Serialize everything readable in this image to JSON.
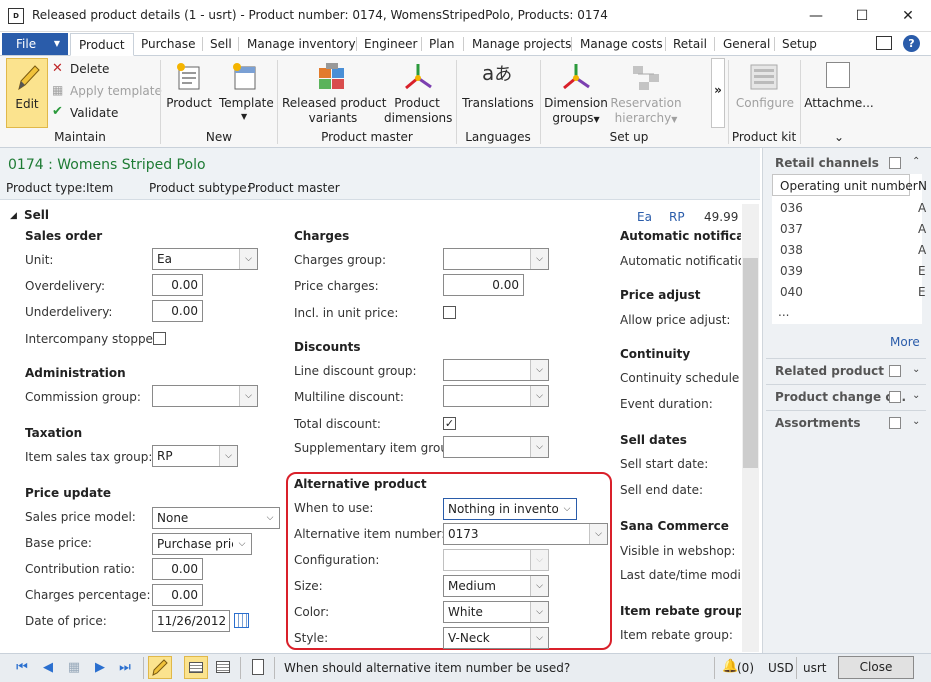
{
  "window": {
    "app_icon_text": "D",
    "title": "Released product details (1 - usrt) - Product number: 0174, WomensStripedPolo, Products: 0174",
    "minimize": "—",
    "maximize": "☐",
    "close": "✕"
  },
  "tabs": {
    "file": "File",
    "items": [
      "Product",
      "Purchase",
      "Sell",
      "Manage inventory",
      "Engineer",
      "Plan",
      "Manage projects",
      "Manage costs",
      "Retail",
      "General",
      "Setup"
    ],
    "active": "Product"
  },
  "ribbon": {
    "maintain": {
      "label": "Maintain",
      "edit": "Edit",
      "delete": "Delete",
      "apply_template": "Apply template",
      "validate": "Validate"
    },
    "new": {
      "label": "New",
      "product": "Product",
      "template": "Template"
    },
    "product_master": {
      "label": "Product master",
      "released_variants_1": "Released product",
      "released_variants_2": "variants",
      "dimensions_1": "Product",
      "dimensions_2": "dimensions"
    },
    "languages": {
      "label": "Languages",
      "translations": "Translations"
    },
    "setup": {
      "label": "Set up",
      "dimension_groups_1": "Dimension",
      "dimension_groups_2": "groups",
      "reservation_1": "Reservation",
      "reservation_2": "hierarchy"
    },
    "more": "»",
    "product_kit": {
      "label": "Product kit",
      "configure": "Configure"
    },
    "attachments": "Attachme...",
    "attach_caret": "⌄"
  },
  "header": {
    "title": "0174 : Womens Striped Polo",
    "product_type_label": "Product type:",
    "product_type_value": "Item",
    "product_subtype_label": "Product subtype:",
    "product_subtype_value": "Product master"
  },
  "section": {
    "title": "Sell",
    "summary_unit": "Ea",
    "summary_tax": "RP",
    "summary_price": "49.99"
  },
  "sales_order": {
    "title": "Sales order",
    "unit_label": "Unit:",
    "unit_value": "Ea",
    "overdelivery_label": "Overdelivery:",
    "overdelivery_value": "0.00",
    "underdelivery_label": "Underdelivery:",
    "underdelivery_value": "0.00",
    "intercompany_label": "Intercompany stopped:"
  },
  "administration": {
    "title": "Administration",
    "commission_label": "Commission group:",
    "commission_value": ""
  },
  "taxation": {
    "title": "Taxation",
    "item_tax_label": "Item sales tax group:",
    "item_tax_value": "RP"
  },
  "price_update": {
    "title": "Price update",
    "model_label": "Sales price model:",
    "model_value": "None",
    "base_label": "Base price:",
    "base_value": "Purchase price",
    "contribution_label": "Contribution ratio:",
    "contribution_value": "0.00",
    "charges_pct_label": "Charges percentage:",
    "charges_pct_value": "0.00",
    "date_label": "Date of price:",
    "date_value": "11/26/2012"
  },
  "charges": {
    "title": "Charges",
    "group_label": "Charges group:",
    "group_value": "",
    "price_label": "Price charges:",
    "price_value": "0.00",
    "incl_label": "Incl. in unit price:"
  },
  "discounts": {
    "title": "Discounts",
    "line_label": "Line discount group:",
    "multiline_label": "Multiline discount:",
    "total_label": "Total discount:",
    "total_checked": "✓",
    "supp_label": "Supplementary item group:"
  },
  "alternative": {
    "title": "Alternative product",
    "when_label": "When to use:",
    "when_value": "Nothing in inventory",
    "alt_item_label": "Alternative item number:",
    "alt_item_value": "0173",
    "config_label": "Configuration:",
    "config_value": "",
    "size_label": "Size:",
    "size_value": "Medium",
    "color_label": "Color:",
    "color_value": "White",
    "style_label": "Style:",
    "style_value": "V-Neck"
  },
  "col3": {
    "auto_title": "Automatic notification",
    "auto_label": "Automatic notification",
    "price_adjust_title": "Price adjust",
    "price_adjust_label": "Allow price adjust:",
    "continuity_title": "Continuity",
    "continuity_schedule_label": "Continuity schedule ID",
    "event_duration_label": "Event duration:",
    "sell_dates_title": "Sell dates",
    "sell_start_label": "Sell start date:",
    "sell_end_label": "Sell end date:",
    "sana_title": "Sana Commerce",
    "visible_label": "Visible in webshop:",
    "last_modified_label": "Last date/time modifie",
    "rebate_title": "Item rebate group",
    "rebate_label": "Item rebate group:"
  },
  "right_pane": {
    "retail_channels": "Retail channels",
    "column_header": "Operating unit number",
    "column_header_2": "N",
    "rows": [
      {
        "unit": "036",
        "extra": "A"
      },
      {
        "unit": "037",
        "extra": "A"
      },
      {
        "unit": "038",
        "extra": "A"
      },
      {
        "unit": "039",
        "extra": "E"
      },
      {
        "unit": "040",
        "extra": "E"
      }
    ],
    "ellipsis": "...",
    "more": "More",
    "related": "Related product ...",
    "product_change": "Product change c...",
    "assortments": "Assortments"
  },
  "status": {
    "help_text": "When should alternative item number be used?",
    "notifications": "(0)",
    "currency": "USD",
    "company": "usrt",
    "close": "Close"
  }
}
